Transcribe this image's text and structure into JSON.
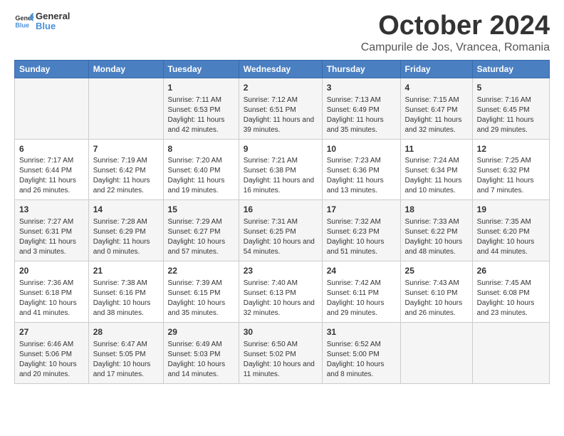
{
  "header": {
    "logo_line1": "General",
    "logo_line2": "Blue",
    "month": "October 2024",
    "location": "Campurile de Jos, Vrancea, Romania"
  },
  "days_of_week": [
    "Sunday",
    "Monday",
    "Tuesday",
    "Wednesday",
    "Thursday",
    "Friday",
    "Saturday"
  ],
  "weeks": [
    [
      {
        "day": "",
        "content": ""
      },
      {
        "day": "",
        "content": ""
      },
      {
        "day": "1",
        "content": "Sunrise: 7:11 AM\nSunset: 6:53 PM\nDaylight: 11 hours and 42 minutes."
      },
      {
        "day": "2",
        "content": "Sunrise: 7:12 AM\nSunset: 6:51 PM\nDaylight: 11 hours and 39 minutes."
      },
      {
        "day": "3",
        "content": "Sunrise: 7:13 AM\nSunset: 6:49 PM\nDaylight: 11 hours and 35 minutes."
      },
      {
        "day": "4",
        "content": "Sunrise: 7:15 AM\nSunset: 6:47 PM\nDaylight: 11 hours and 32 minutes."
      },
      {
        "day": "5",
        "content": "Sunrise: 7:16 AM\nSunset: 6:45 PM\nDaylight: 11 hours and 29 minutes."
      }
    ],
    [
      {
        "day": "6",
        "content": "Sunrise: 7:17 AM\nSunset: 6:44 PM\nDaylight: 11 hours and 26 minutes."
      },
      {
        "day": "7",
        "content": "Sunrise: 7:19 AM\nSunset: 6:42 PM\nDaylight: 11 hours and 22 minutes."
      },
      {
        "day": "8",
        "content": "Sunrise: 7:20 AM\nSunset: 6:40 PM\nDaylight: 11 hours and 19 minutes."
      },
      {
        "day": "9",
        "content": "Sunrise: 7:21 AM\nSunset: 6:38 PM\nDaylight: 11 hours and 16 minutes."
      },
      {
        "day": "10",
        "content": "Sunrise: 7:23 AM\nSunset: 6:36 PM\nDaylight: 11 hours and 13 minutes."
      },
      {
        "day": "11",
        "content": "Sunrise: 7:24 AM\nSunset: 6:34 PM\nDaylight: 11 hours and 10 minutes."
      },
      {
        "day": "12",
        "content": "Sunrise: 7:25 AM\nSunset: 6:32 PM\nDaylight: 11 hours and 7 minutes."
      }
    ],
    [
      {
        "day": "13",
        "content": "Sunrise: 7:27 AM\nSunset: 6:31 PM\nDaylight: 11 hours and 3 minutes."
      },
      {
        "day": "14",
        "content": "Sunrise: 7:28 AM\nSunset: 6:29 PM\nDaylight: 11 hours and 0 minutes."
      },
      {
        "day": "15",
        "content": "Sunrise: 7:29 AM\nSunset: 6:27 PM\nDaylight: 10 hours and 57 minutes."
      },
      {
        "day": "16",
        "content": "Sunrise: 7:31 AM\nSunset: 6:25 PM\nDaylight: 10 hours and 54 minutes."
      },
      {
        "day": "17",
        "content": "Sunrise: 7:32 AM\nSunset: 6:23 PM\nDaylight: 10 hours and 51 minutes."
      },
      {
        "day": "18",
        "content": "Sunrise: 7:33 AM\nSunset: 6:22 PM\nDaylight: 10 hours and 48 minutes."
      },
      {
        "day": "19",
        "content": "Sunrise: 7:35 AM\nSunset: 6:20 PM\nDaylight: 10 hours and 44 minutes."
      }
    ],
    [
      {
        "day": "20",
        "content": "Sunrise: 7:36 AM\nSunset: 6:18 PM\nDaylight: 10 hours and 41 minutes."
      },
      {
        "day": "21",
        "content": "Sunrise: 7:38 AM\nSunset: 6:16 PM\nDaylight: 10 hours and 38 minutes."
      },
      {
        "day": "22",
        "content": "Sunrise: 7:39 AM\nSunset: 6:15 PM\nDaylight: 10 hours and 35 minutes."
      },
      {
        "day": "23",
        "content": "Sunrise: 7:40 AM\nSunset: 6:13 PM\nDaylight: 10 hours and 32 minutes."
      },
      {
        "day": "24",
        "content": "Sunrise: 7:42 AM\nSunset: 6:11 PM\nDaylight: 10 hours and 29 minutes."
      },
      {
        "day": "25",
        "content": "Sunrise: 7:43 AM\nSunset: 6:10 PM\nDaylight: 10 hours and 26 minutes."
      },
      {
        "day": "26",
        "content": "Sunrise: 7:45 AM\nSunset: 6:08 PM\nDaylight: 10 hours and 23 minutes."
      }
    ],
    [
      {
        "day": "27",
        "content": "Sunrise: 6:46 AM\nSunset: 5:06 PM\nDaylight: 10 hours and 20 minutes."
      },
      {
        "day": "28",
        "content": "Sunrise: 6:47 AM\nSunset: 5:05 PM\nDaylight: 10 hours and 17 minutes."
      },
      {
        "day": "29",
        "content": "Sunrise: 6:49 AM\nSunset: 5:03 PM\nDaylight: 10 hours and 14 minutes."
      },
      {
        "day": "30",
        "content": "Sunrise: 6:50 AM\nSunset: 5:02 PM\nDaylight: 10 hours and 11 minutes."
      },
      {
        "day": "31",
        "content": "Sunrise: 6:52 AM\nSunset: 5:00 PM\nDaylight: 10 hours and 8 minutes."
      },
      {
        "day": "",
        "content": ""
      },
      {
        "day": "",
        "content": ""
      }
    ]
  ]
}
